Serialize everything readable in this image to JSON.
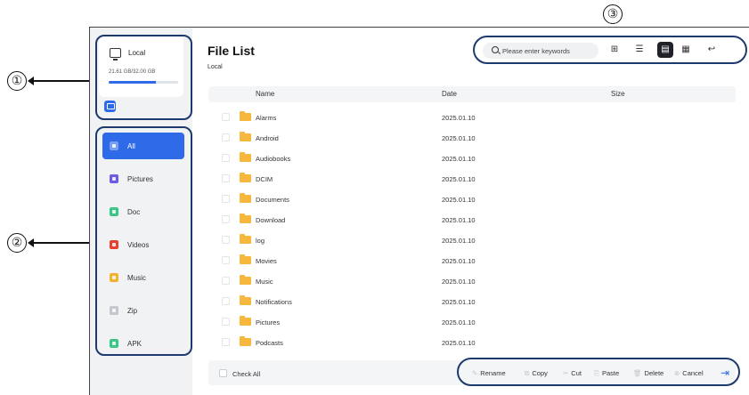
{
  "annotations": {
    "one": "①",
    "two": "②",
    "three_top": "③",
    "three_bottom": "③"
  },
  "storage": {
    "name": "Local",
    "capacity": "21.61 GB/32.00 GB",
    "used_fraction": 0.675
  },
  "categories": [
    {
      "label": "All",
      "icon": "grid-icon",
      "color": "#2f6be8",
      "active": true
    },
    {
      "label": "Pictures",
      "icon": "picture-icon",
      "color": "#6b5ce7"
    },
    {
      "label": "Doc",
      "icon": "doc-icon",
      "color": "#3cc68a"
    },
    {
      "label": "Videos",
      "icon": "video-icon",
      "color": "#e8412f"
    },
    {
      "label": "Music",
      "icon": "music-icon",
      "color": "#f4b22f"
    },
    {
      "label": "Zip",
      "icon": "zip-icon",
      "color": "#c3c7ce"
    },
    {
      "label": "APK",
      "icon": "android-icon",
      "color": "#3cc68a"
    }
  ],
  "header": {
    "title": "File List",
    "breadcrumb": "Local"
  },
  "search": {
    "placeholder": "Please enter keywords"
  },
  "toolbar": {
    "new_folder_icon": "new-folder-icon",
    "sort_icon": "sort-icon",
    "list_view_icon": "list-view-icon",
    "grid_view_icon": "grid-view-icon",
    "back_icon": "back-icon"
  },
  "table": {
    "columns": {
      "name": "Name",
      "date": "Date",
      "size": "Size"
    },
    "rows": [
      {
        "name": "Alarms",
        "date": "2025.01.10"
      },
      {
        "name": "Android",
        "date": "2025.01.10"
      },
      {
        "name": "Audiobooks",
        "date": "2025.01.10"
      },
      {
        "name": "DCIM",
        "date": "2025.01.10"
      },
      {
        "name": "Documents",
        "date": "2025.01.10"
      },
      {
        "name": "Download",
        "date": "2025.01.10"
      },
      {
        "name": "log",
        "date": "2025.01.10"
      },
      {
        "name": "Movies",
        "date": "2025.01.10"
      },
      {
        "name": "Music",
        "date": "2025.01.10"
      },
      {
        "name": "Notifications",
        "date": "2025.01.10"
      },
      {
        "name": "Pictures",
        "date": "2025.01.10"
      },
      {
        "name": "Podcasts",
        "date": "2025.01.10"
      }
    ]
  },
  "bottom": {
    "check_all": "Check All",
    "rename": "Rename",
    "copy": "Copy",
    "cut": "Cut",
    "paste": "Paste",
    "delete": "Delete",
    "cancel": "Cancel"
  },
  "colors": {
    "accent": "#2f6be8",
    "folder": "#f6b73c",
    "annotation_outline": "#1d3a6e"
  }
}
